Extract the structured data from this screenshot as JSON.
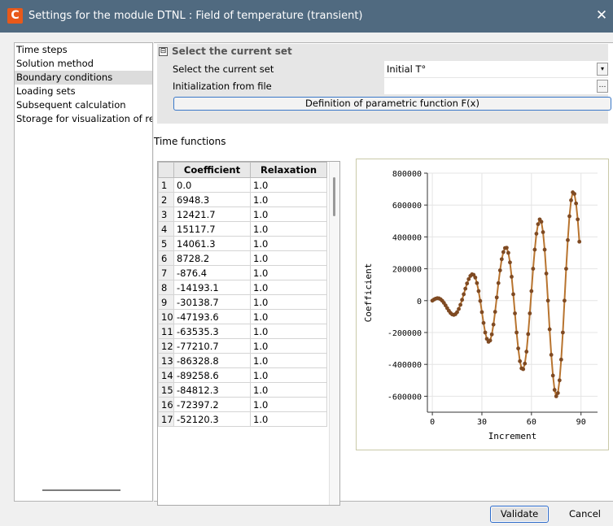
{
  "window": {
    "title": "Settings for the module DTNL : Field of temperature (transient)",
    "icon_letter": "C"
  },
  "nav": {
    "items": [
      {
        "label": "Time steps"
      },
      {
        "label": "Solution method"
      },
      {
        "label": "Boundary conditions",
        "selected": true
      },
      {
        "label": "Loading sets"
      },
      {
        "label": "Subsequent calculation"
      },
      {
        "label": "Storage for visualization of res"
      }
    ]
  },
  "group": {
    "title": "Select the current set",
    "collapse_glyph": "⊟",
    "rows": [
      {
        "label": "Select the current set",
        "value": "Initial T°"
      },
      {
        "label": "Initialization from file",
        "value": ""
      }
    ],
    "definition_button": "Definition of parametric function F(x)"
  },
  "time_functions": {
    "label": "Time functions",
    "columns": [
      "Coefficient",
      "Relaxation"
    ],
    "rows": [
      [
        "1",
        "0.0",
        "1.0"
      ],
      [
        "2",
        "6948.3",
        "1.0"
      ],
      [
        "3",
        "12421.7",
        "1.0"
      ],
      [
        "4",
        "15117.7",
        "1.0"
      ],
      [
        "5",
        "14061.3",
        "1.0"
      ],
      [
        "6",
        "8728.2",
        "1.0"
      ],
      [
        "7",
        "-876.4",
        "1.0"
      ],
      [
        "8",
        "-14193.1",
        "1.0"
      ],
      [
        "9",
        "-30138.7",
        "1.0"
      ],
      [
        "10",
        "-47193.6",
        "1.0"
      ],
      [
        "11",
        "-63535.3",
        "1.0"
      ],
      [
        "12",
        "-77210.7",
        "1.0"
      ],
      [
        "13",
        "-86328.8",
        "1.0"
      ],
      [
        "14",
        "-89258.6",
        "1.0"
      ],
      [
        "15",
        "-84812.3",
        "1.0"
      ],
      [
        "16",
        "-72397.2",
        "1.0"
      ],
      [
        "17",
        "-52120.3",
        "1.0"
      ]
    ]
  },
  "chart_data": {
    "type": "line",
    "xlabel": "Increment",
    "ylabel": "Coefficient",
    "xlim": [
      -3,
      100
    ],
    "ylim": [
      -700000,
      800000
    ],
    "xticks": [
      "0",
      "30",
      "60",
      "90"
    ],
    "xtick_values": [
      0,
      30,
      60,
      90
    ],
    "yticks": [
      "800000",
      "600000",
      "400000",
      "200000",
      "0",
      "-200000",
      "-400000",
      "-600000"
    ],
    "ytick_values": [
      800000,
      600000,
      400000,
      200000,
      0,
      -200000,
      -400000,
      -600000
    ],
    "line_color": "#b8742f",
    "marker_color": "#7f4a22",
    "grid": true,
    "series": [
      {
        "values": [
          0,
          6948.3,
          12421.7,
          15117.7,
          14061.3,
          8728.2,
          -876.4,
          -14193.1,
          -30138.7,
          -47193.6,
          -63535.3,
          -77210.7,
          -86328.8,
          -89258.6,
          -84812.3,
          -72397.2,
          -52120.3,
          -26000,
          5000,
          40000,
          75000,
          108000,
          135000,
          155000,
          165000,
          162000,
          145000,
          110000,
          60000,
          -2000,
          -72000,
          -140000,
          -200000,
          -240000,
          -258000,
          -250000,
          -212000,
          -150000,
          -70000,
          20000,
          110000,
          190000,
          260000,
          305000,
          330000,
          332000,
          300000,
          240000,
          150000,
          40000,
          -80000,
          -200000,
          -300000,
          -380000,
          -425000,
          -430000,
          -395000,
          -320000,
          -210000,
          -80000,
          60000,
          200000,
          320000,
          420000,
          480000,
          510000,
          495000,
          430000,
          320000,
          170000,
          0,
          -180000,
          -340000,
          -470000,
          -560000,
          -600000,
          -580000,
          -500000,
          -370000,
          -200000,
          0,
          200000,
          380000,
          530000,
          630000,
          680000,
          670000,
          610000,
          510000,
          370000
        ]
      }
    ]
  },
  "footer": {
    "validate": "Validate",
    "cancel": "Cancel"
  }
}
